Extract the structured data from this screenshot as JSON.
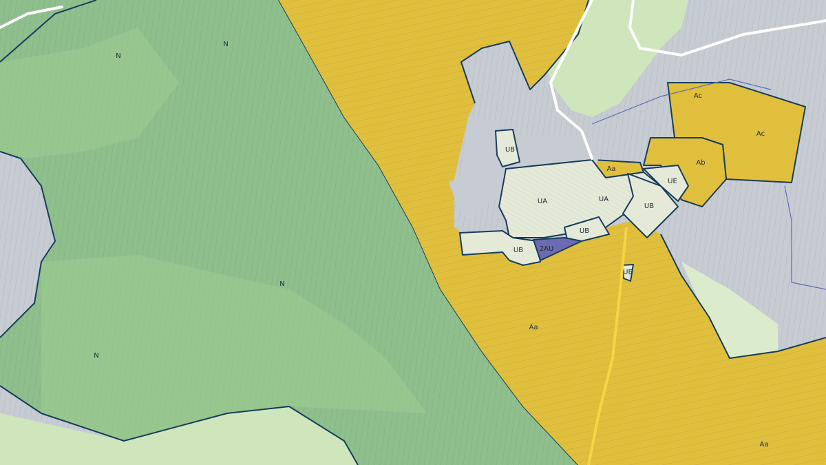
{
  "labels": {
    "n_1": "N",
    "n_2": "N",
    "n_3": "N",
    "n_4": "N",
    "ac_1": "Ac",
    "ac_2": "Ac",
    "ab": "Ab",
    "aa_1": "Aa",
    "aa_2": "Aa",
    "aa_3": "Aa",
    "ua_1": "UA",
    "ua_2": "UA",
    "ub_1": "UB",
    "ub_2": "UB",
    "ub_3": "UB",
    "ub_4": "UB",
    "ue_1": "UE",
    "ue_2": "UE",
    "au_2": "2AU"
  },
  "colors": {
    "zone_N": "#8fbf8c",
    "zone_A": "#e0bf3d",
    "zone_U": "#e4ead7",
    "zone_2AU": "#6c6ab0",
    "background_parcels": "#c7ccd3",
    "light_green": "#cfe6bd",
    "outline": "#173c5c"
  }
}
